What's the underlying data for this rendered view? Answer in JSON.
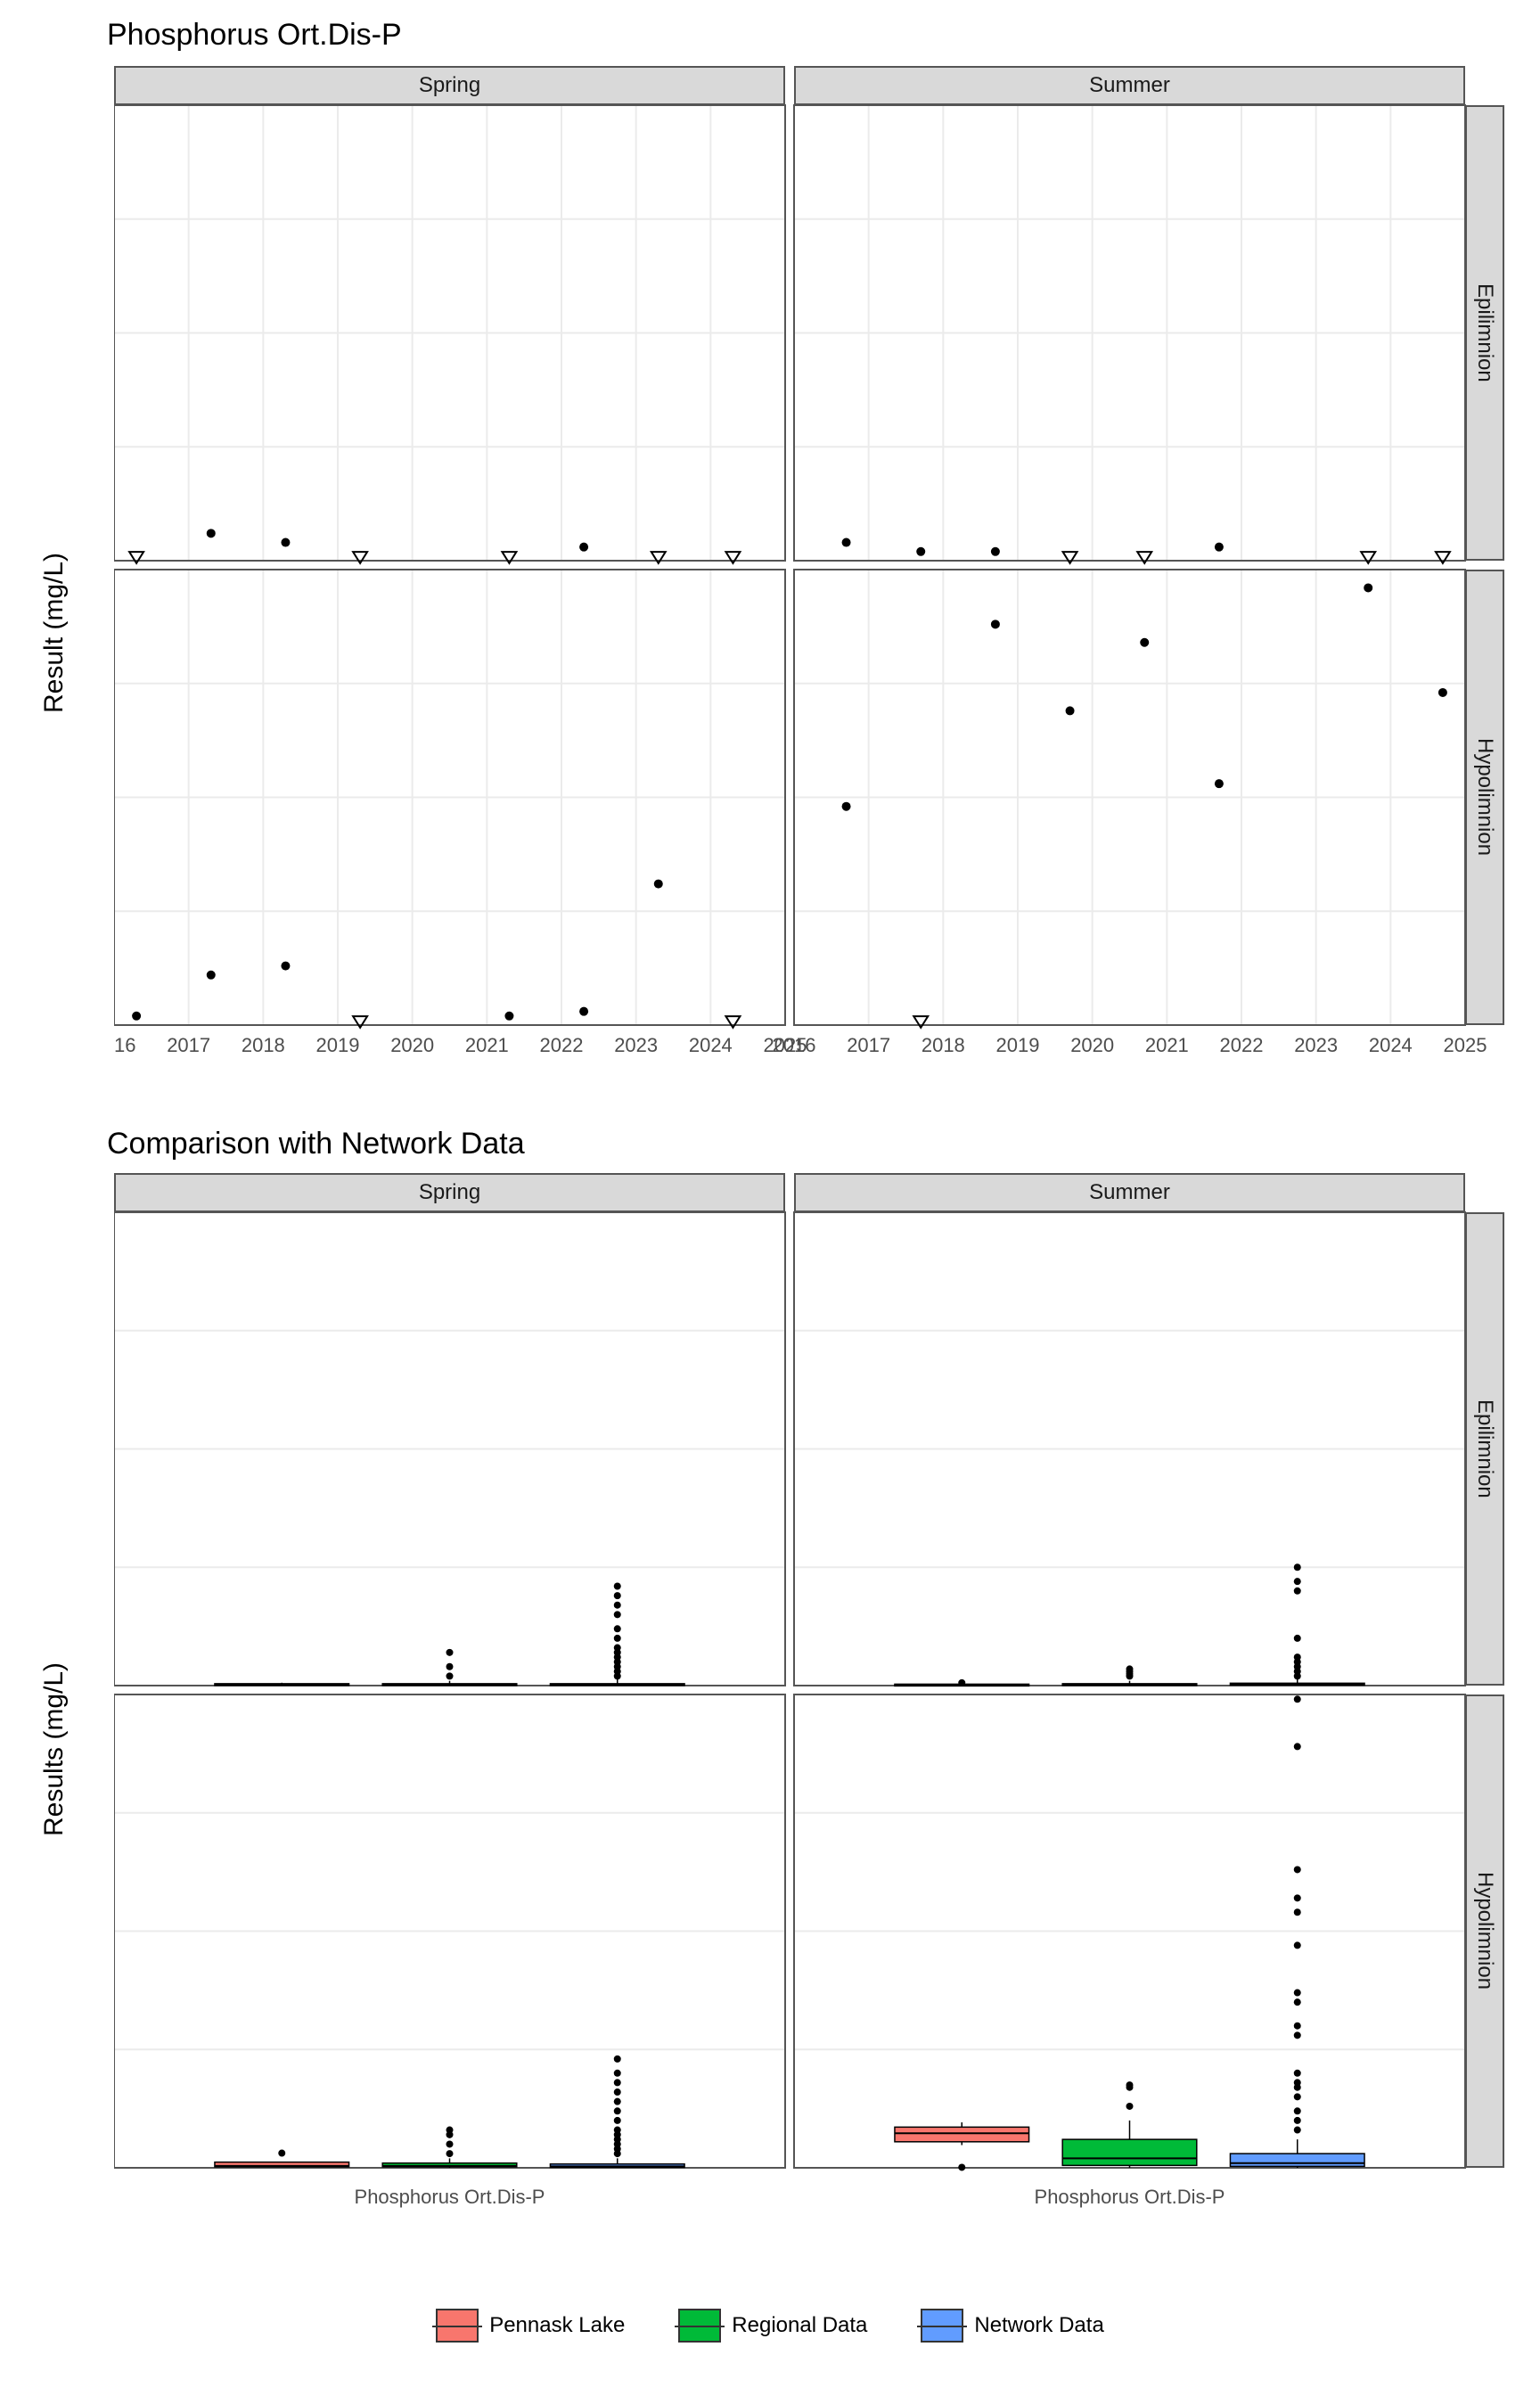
{
  "top_title": "Phosphorus Ort.Dis-P",
  "top_ylabel": "Result (mg/L)",
  "bottom_title": "Comparison with Network Data",
  "bottom_ylabel": "Results (mg/L)",
  "top_strip_cols": [
    "Spring",
    "Summer"
  ],
  "top_strip_rows": [
    "Epilimnion",
    "Hypolimnion"
  ],
  "bottom_strip_cols": [
    "Spring",
    "Summer"
  ],
  "bottom_strip_rows": [
    "Epilimnion",
    "Hypolimnion"
  ],
  "bottom_xlabel": "Phosphorus Ort.Dis-P",
  "legend": [
    "Pennask Lake",
    "Regional Data",
    "Network Data"
  ],
  "chart_data": [
    {
      "type": "scatter",
      "title": "Phosphorus Ort.Dis-P — faceted time series",
      "ylabel": "Result (mg/L)",
      "xlabel": "",
      "facet_cols": [
        "Spring",
        "Summer"
      ],
      "facet_rows": [
        "Epilimnion",
        "Hypolimnion"
      ],
      "xlim": [
        2016,
        2025
      ],
      "ylim": [
        0,
        0.1
      ],
      "xticks": [
        2016,
        2017,
        2018,
        2019,
        2020,
        2021,
        2022,
        2023,
        2024,
        2025
      ],
      "yticks": [
        0.0,
        0.025,
        0.05,
        0.075,
        0.1
      ],
      "series": [
        {
          "facet": "Spring/Epilimnion",
          "shape": "dot",
          "points": [
            [
              2017.3,
              0.006
            ],
            [
              2018.3,
              0.004
            ],
            [
              2022.3,
              0.003
            ]
          ]
        },
        {
          "facet": "Spring/Epilimnion",
          "shape": "triangle",
          "points": [
            [
              2016.3,
              0.001
            ],
            [
              2019.3,
              0.001
            ],
            [
              2021.3,
              0.001
            ],
            [
              2023.3,
              0.001
            ],
            [
              2024.3,
              0.001
            ]
          ]
        },
        {
          "facet": "Summer/Epilimnion",
          "shape": "dot",
          "points": [
            [
              2016.7,
              0.004
            ],
            [
              2017.7,
              0.002
            ],
            [
              2018.7,
              0.002
            ],
            [
              2021.7,
              0.003
            ]
          ]
        },
        {
          "facet": "Summer/Epilimnion",
          "shape": "triangle",
          "points": [
            [
              2019.7,
              0.001
            ],
            [
              2020.7,
              0.001
            ],
            [
              2023.7,
              0.001
            ],
            [
              2024.7,
              0.001
            ]
          ]
        },
        {
          "facet": "Spring/Hypolimnion",
          "shape": "dot",
          "points": [
            [
              2016.3,
              0.002
            ],
            [
              2017.3,
              0.011
            ],
            [
              2018.3,
              0.013
            ],
            [
              2021.3,
              0.002
            ],
            [
              2022.3,
              0.003
            ],
            [
              2023.3,
              0.031
            ]
          ]
        },
        {
          "facet": "Spring/Hypolimnion",
          "shape": "triangle",
          "points": [
            [
              2019.3,
              0.001
            ],
            [
              2024.3,
              0.001
            ]
          ]
        },
        {
          "facet": "Summer/Hypolimnion",
          "shape": "dot",
          "points": [
            [
              2016.7,
              0.048
            ],
            [
              2018.7,
              0.088
            ],
            [
              2019.7,
              0.069
            ],
            [
              2020.7,
              0.084
            ],
            [
              2021.7,
              0.053
            ],
            [
              2023.7,
              0.096
            ],
            [
              2024.7,
              0.073
            ]
          ]
        },
        {
          "facet": "Summer/Hypolimnion",
          "shape": "triangle",
          "points": [
            [
              2017.7,
              0.001
            ]
          ]
        }
      ]
    },
    {
      "type": "boxplot",
      "title": "Comparison with Network Data — faceted boxplots",
      "ylabel": "Results (mg/L)",
      "xlabel": "Phosphorus Ort.Dis-P",
      "facet_cols": [
        "Spring",
        "Summer"
      ],
      "facet_rows": [
        "Epilimnion",
        "Hypolimnion"
      ],
      "ylim": [
        0,
        1.0
      ],
      "yticks": [
        0.0,
        0.25,
        0.5,
        0.75,
        1.0
      ],
      "categories": [
        "Pennask Lake",
        "Regional Data",
        "Network Data"
      ],
      "colors": {
        "Pennask Lake": "#f8766d",
        "Regional Data": "#00ba38",
        "Network Data": "#619cff"
      },
      "boxes": [
        {
          "facet": "Spring/Epilimnion",
          "series": "Pennask Lake",
          "min": 0.001,
          "q1": 0.001,
          "med": 0.002,
          "q3": 0.004,
          "max": 0.006,
          "outliers": []
        },
        {
          "facet": "Spring/Epilimnion",
          "series": "Regional Data",
          "min": 0.0,
          "q1": 0.001,
          "med": 0.002,
          "q3": 0.004,
          "max": 0.01,
          "outliers": [
            0.02,
            0.04,
            0.07
          ]
        },
        {
          "facet": "Spring/Epilimnion",
          "series": "Network Data",
          "min": 0.0,
          "q1": 0.001,
          "med": 0.002,
          "q3": 0.004,
          "max": 0.015,
          "outliers": [
            0.02,
            0.03,
            0.04,
            0.05,
            0.06,
            0.07,
            0.08,
            0.1,
            0.12,
            0.15,
            0.17,
            0.19,
            0.21
          ]
        },
        {
          "facet": "Summer/Epilimnion",
          "series": "Pennask Lake",
          "min": 0.001,
          "q1": 0.001,
          "med": 0.002,
          "q3": 0.003,
          "max": 0.004,
          "outliers": [
            0.006
          ]
        },
        {
          "facet": "Summer/Epilimnion",
          "series": "Regional Data",
          "min": 0.0,
          "q1": 0.001,
          "med": 0.002,
          "q3": 0.004,
          "max": 0.01,
          "outliers": [
            0.02,
            0.025,
            0.03,
            0.035
          ]
        },
        {
          "facet": "Summer/Epilimnion",
          "series": "Network Data",
          "min": 0.0,
          "q1": 0.001,
          "med": 0.002,
          "q3": 0.005,
          "max": 0.015,
          "outliers": [
            0.02,
            0.03,
            0.04,
            0.05,
            0.06,
            0.1,
            0.2,
            0.22,
            0.25
          ]
        },
        {
          "facet": "Spring/Hypolimnion",
          "series": "Pennask Lake",
          "min": 0.001,
          "q1": 0.002,
          "med": 0.004,
          "q3": 0.012,
          "max": 0.013,
          "outliers": [
            0.031
          ]
        },
        {
          "facet": "Spring/Hypolimnion",
          "series": "Regional Data",
          "min": 0.0,
          "q1": 0.002,
          "med": 0.004,
          "q3": 0.01,
          "max": 0.02,
          "outliers": [
            0.03,
            0.05,
            0.07,
            0.08
          ]
        },
        {
          "facet": "Spring/Hypolimnion",
          "series": "Network Data",
          "min": 0.0,
          "q1": 0.001,
          "med": 0.003,
          "q3": 0.008,
          "max": 0.02,
          "outliers": [
            0.03,
            0.04,
            0.05,
            0.06,
            0.07,
            0.08,
            0.1,
            0.12,
            0.14,
            0.16,
            0.18,
            0.2,
            0.23
          ]
        },
        {
          "facet": "Summer/Hypolimnion",
          "series": "Pennask Lake",
          "min": 0.048,
          "q1": 0.055,
          "med": 0.073,
          "q3": 0.086,
          "max": 0.096,
          "outliers": [
            0.001
          ]
        },
        {
          "facet": "Summer/Hypolimnion",
          "series": "Regional Data",
          "min": 0.0,
          "q1": 0.005,
          "med": 0.02,
          "q3": 0.06,
          "max": 0.1,
          "outliers": [
            0.13,
            0.17,
            0.175
          ]
        },
        {
          "facet": "Summer/Hypolimnion",
          "series": "Network Data",
          "min": 0.0,
          "q1": 0.003,
          "med": 0.01,
          "q3": 0.03,
          "max": 0.06,
          "outliers": [
            0.08,
            0.1,
            0.12,
            0.15,
            0.17,
            0.18,
            0.2,
            0.28,
            0.3,
            0.35,
            0.37,
            0.47,
            0.54,
            0.57,
            0.63,
            0.89,
            0.99
          ]
        }
      ]
    }
  ]
}
